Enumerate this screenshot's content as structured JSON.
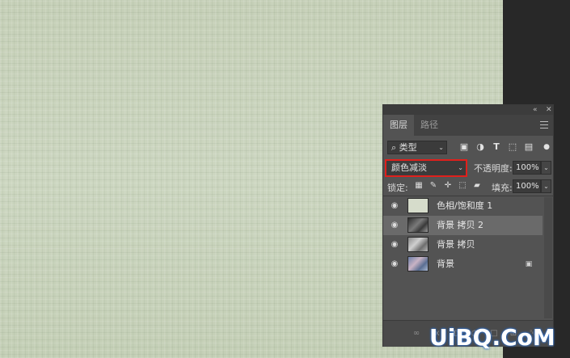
{
  "panel": {
    "tabs": [
      {
        "label": "图层",
        "active": true
      },
      {
        "label": "路径",
        "active": false
      }
    ],
    "filter": {
      "search_icon": "search-icon",
      "selected": "类型",
      "icons": [
        "image-filter-icon",
        "adjustment-filter-icon",
        "type-filter-icon",
        "shape-filter-icon",
        "smart-object-filter-icon"
      ]
    },
    "blend_mode": {
      "value": "颜色减淡",
      "highlight_color": "#e0201c"
    },
    "opacity": {
      "label": "不透明度:",
      "value": "100%"
    },
    "lock": {
      "label": "锁定:",
      "icons": [
        "lock-transparent-icon",
        "lock-paint-icon",
        "lock-move-icon",
        "lock-artboard-icon",
        "lock-all-icon"
      ]
    },
    "fill": {
      "label": "填充:",
      "value": "100%"
    },
    "layers": [
      {
        "name": "色相/饱和度 1",
        "visible": true,
        "selected": false,
        "locked": false,
        "thumb": "adjustment"
      },
      {
        "name": "背景 拷贝 2",
        "visible": true,
        "selected": true,
        "locked": false,
        "thumb": "photo-dark"
      },
      {
        "name": "背景 拷贝",
        "visible": true,
        "selected": false,
        "locked": false,
        "thumb": "photo-gray"
      },
      {
        "name": "背景",
        "visible": true,
        "selected": false,
        "locked": true,
        "thumb": "photo-color"
      }
    ],
    "bottom_icons": [
      "link-icon",
      "fx-icon",
      "mask-icon",
      "adjustment-layer-icon",
      "group-icon",
      "new-layer-icon",
      "trash-icon"
    ]
  },
  "watermark": {
    "text": "UiBQ.CoM"
  },
  "colors": {
    "canvas": "#c9d3bd",
    "panel": "#535353",
    "selected_layer": "#6a6a6a"
  }
}
